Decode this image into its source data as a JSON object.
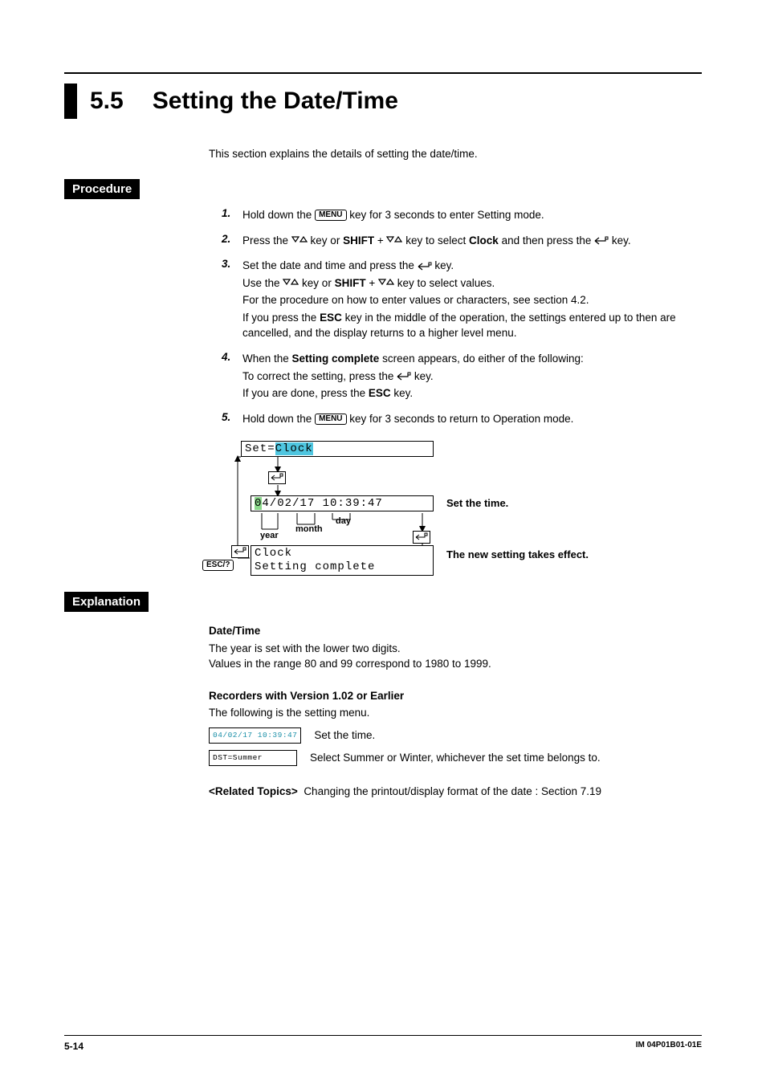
{
  "title": {
    "num": "5.5",
    "text": "Setting the Date/Time"
  },
  "intro": "This section explains the details of setting the date/time.",
  "labels": {
    "procedure": "Procedure",
    "explanation": "Explanation"
  },
  "keys": {
    "menu": "MENU",
    "esc": "ESC/?"
  },
  "proc": {
    "n1": "1.",
    "n2": "2.",
    "n3": "3.",
    "n4": "4.",
    "n5": "5.",
    "p1a": "Hold down the ",
    "p1b": " key for 3 seconds to enter Setting mode.",
    "p2a": "Press the ",
    "p2b": " key or ",
    "p2shift": "SHIFT",
    "p2c": " + ",
    "p2d": " key to select ",
    "p2clock": "Clock",
    "p2e": " and then press the ",
    "p2f": " key.",
    "p3a": "Set the date and time and press the ",
    "p3b": " key.",
    "p3c": "Use the ",
    "p3d": " key or ",
    "p3e": " + ",
    "p3f": " key to select values.",
    "p3g": "For the procedure on how to enter values or characters, see section 4.2.",
    "p3h1": "If you press the ",
    "p3esc": "ESC",
    "p3h2": " key in the middle of the operation, the settings entered up to then are cancelled, and the display returns to a higher level menu.",
    "p4a": "When the ",
    "p4sc": "Setting complete",
    "p4b": " screen appears, do either of the following:",
    "p4c": "To correct the setting, press the ",
    "p4d": " key.",
    "p4e": "If you are done, press the ",
    "p4esc": "ESC",
    "p4f": " key.",
    "p5a": "Hold down the ",
    "p5b": " key for 3 seconds to return to Operation mode."
  },
  "diagram": {
    "row1_pre": "Set=",
    "row1_hl": "Clock",
    "row2_hl": "0",
    "row2_rest": "4/02/17 10:39:47",
    "row3_a": "Clock",
    "row3_b": "Setting complete",
    "year": "year",
    "month": "month",
    "day": "day",
    "set_time": "Set the time.",
    "effect": "The new setting takes effect."
  },
  "expl": {
    "dt_h": "Date/Time",
    "dt_1": "The year is set with the lower two digits.",
    "dt_2": "Values in the range 80 and 99 correspond to 1980 to 1999.",
    "rec_h": "Recorders with Version 1.02 or Earlier",
    "rec_1": "The following is the setting menu.",
    "mini1": "04/02/17 10:39:47",
    "mini1_lbl": "Set the time.",
    "mini2": "DST=Summer",
    "mini2_lbl": "Select Summer or Winter, whichever the set time belongs to.",
    "rel_h": "<Related Topics>",
    "rel_t": "Changing the printout/display format of the date : Section 7.19"
  },
  "footer": {
    "page": "5-14",
    "doc": "IM 04P01B01-01E"
  }
}
